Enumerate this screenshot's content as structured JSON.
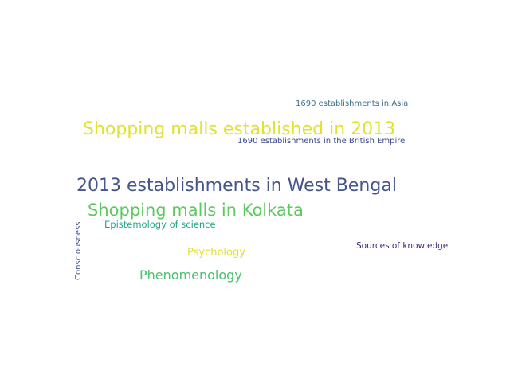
{
  "word_cloud": {
    "words": [
      {
        "text": "1690 establishments in Asia",
        "color": "#3b6e8f"
      },
      {
        "text": "Shopping malls established in 2013",
        "color": "#dfe32d"
      },
      {
        "text": "1690 establishments in the British Empire",
        "color": "#3e4a89"
      },
      {
        "text": "2013 establishments in West Bengal",
        "color": "#46558a"
      },
      {
        "text": "Shopping malls in Kolkata",
        "color": "#5ec962"
      },
      {
        "text": "Epistemology of science",
        "color": "#21a585"
      },
      {
        "text": "Sources of knowledge",
        "color": "#482677"
      },
      {
        "text": "Psychology",
        "color": "#dfe32d"
      },
      {
        "text": "Phenomenology",
        "color": "#4ac16d"
      },
      {
        "text": "Consciousness",
        "color": "#46558a"
      }
    ]
  }
}
